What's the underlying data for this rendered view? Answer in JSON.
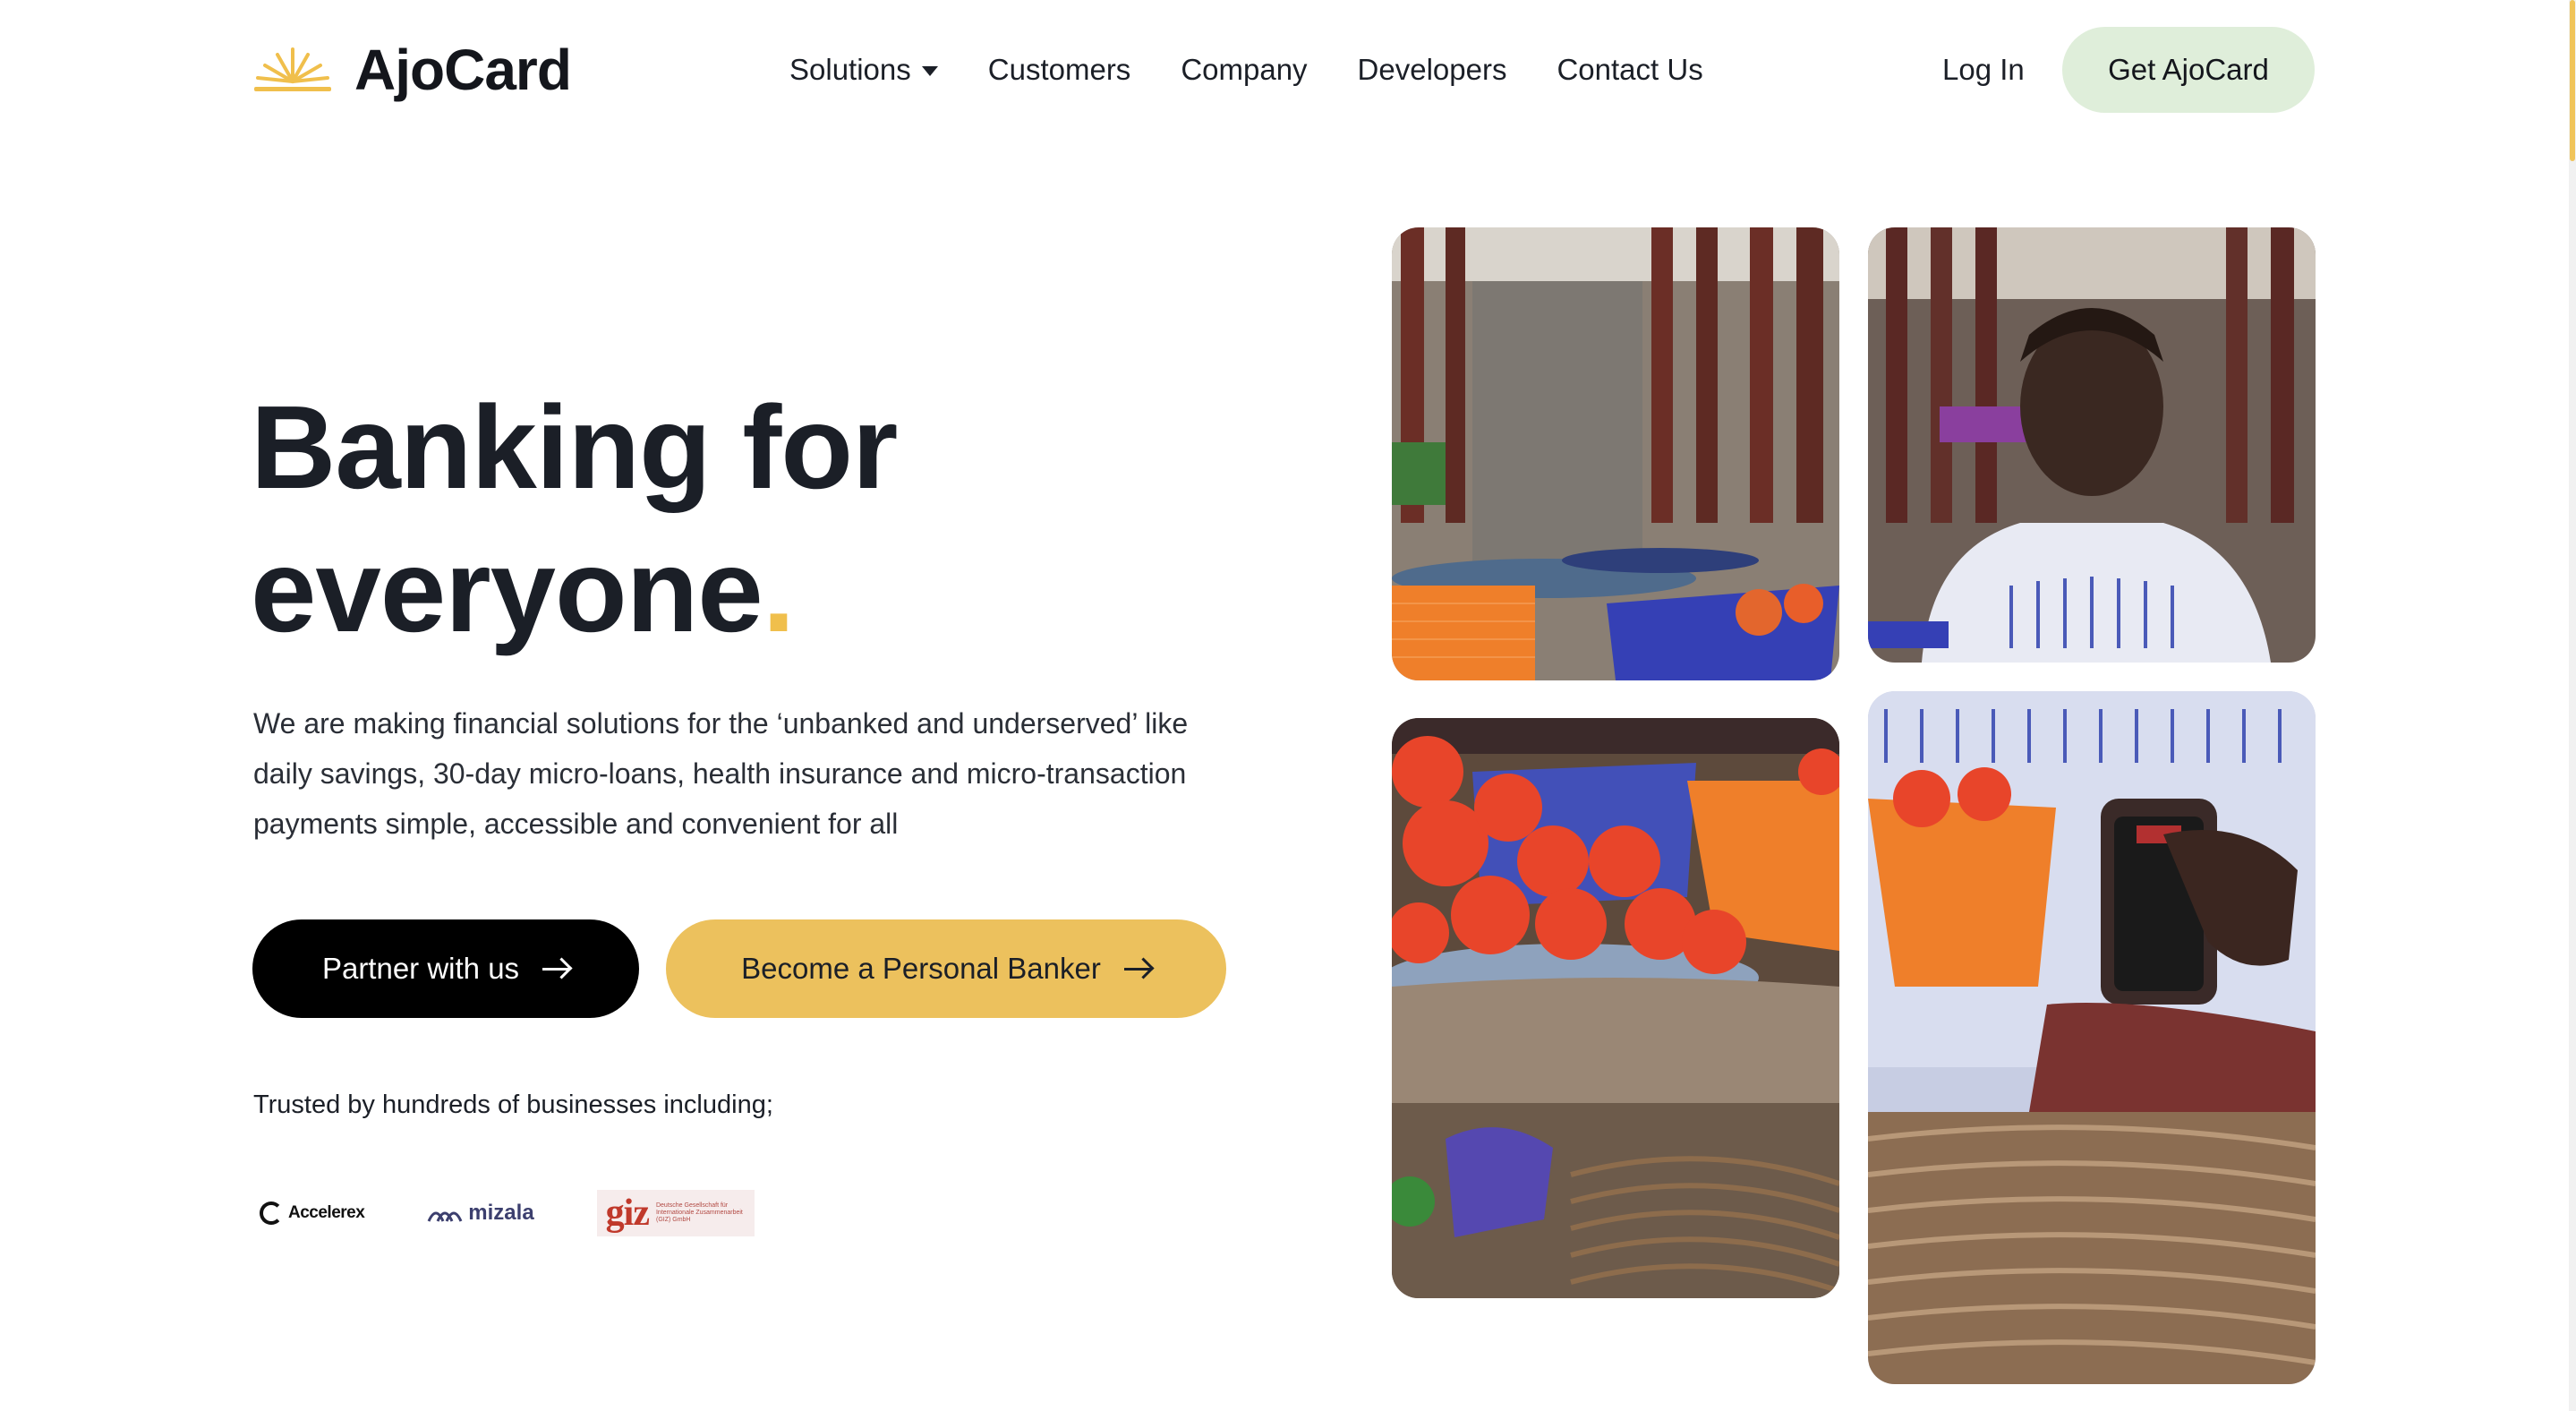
{
  "brand": {
    "name": "AjoCard",
    "accent_color": "#f0bf4c",
    "logo_icon": "sunrise-icon"
  },
  "nav": {
    "items": [
      {
        "label": "Solutions",
        "has_dropdown": true
      },
      {
        "label": "Customers"
      },
      {
        "label": "Company"
      },
      {
        "label": "Developers"
      },
      {
        "label": "Contact Us"
      }
    ],
    "login_label": "Log In",
    "cta_label": "Get AjoCard",
    "cta_color": "#dfeeda"
  },
  "hero": {
    "headline_line1": "Banking for",
    "headline_line2": "everyone",
    "headline_dot": ".",
    "subtext": "We are making financial solutions for the ‘unbanked and underserved’ like daily savings, 30-day micro-loans, health insurance and micro-transaction payments simple, accessible and convenient for all",
    "primary_button": "Partner with us",
    "secondary_button": "Become a Personal Banker",
    "primary_button_color": "#000000",
    "secondary_button_color": "#ecc15d",
    "trusted_text": "Trusted by hundreds of businesses including;",
    "partners": [
      {
        "name": "Accelerex"
      },
      {
        "name": "mizala"
      },
      {
        "name": "giz",
        "subtitle": "Deutsche Gesellschaft für Internationale Zusammenarbeit (GIZ) GmbH"
      }
    ]
  },
  "gallery": {
    "images": [
      {
        "name": "market-baskets-photo"
      },
      {
        "name": "market-woman-photo"
      },
      {
        "name": "tomatoes-table-photo"
      },
      {
        "name": "phone-payment-photo"
      }
    ]
  }
}
